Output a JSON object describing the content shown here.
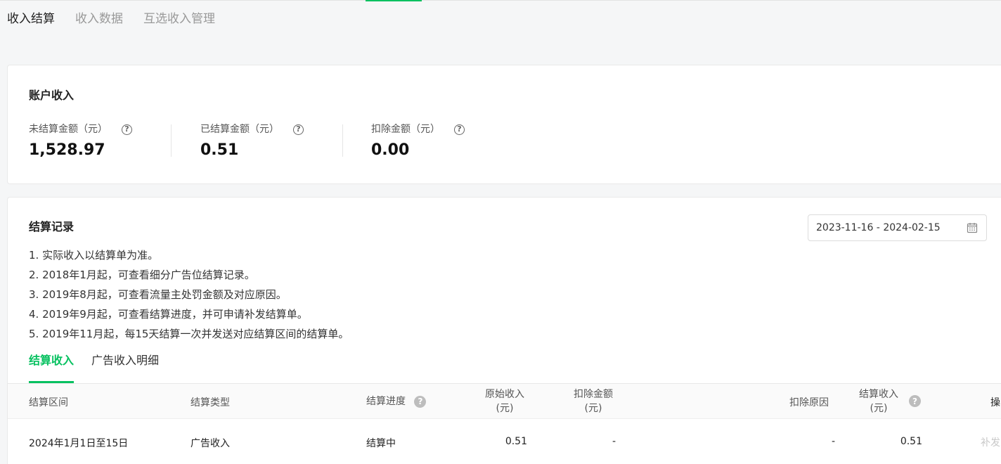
{
  "page_tabs": [
    "收入结算",
    "收入数据",
    "互选收入管理"
  ],
  "account": {
    "title": "账户收入",
    "metrics": [
      {
        "label": "未结算金额（元）",
        "value": "1,528.97"
      },
      {
        "label": "已结算金额（元）",
        "value": "0.51"
      },
      {
        "label": "扣除金额（元）",
        "value": "0.00"
      }
    ]
  },
  "records": {
    "title": "结算记录",
    "date_range": "2023-11-16 - 2024-02-15",
    "notes": [
      "1. 实际收入以结算单为准。",
      "2. 2018年1月起，可查看细分广告位结算记录。",
      "3. 2019年8月起，可查看流量主处罚金额及对应原因。",
      "4. 2019年9月起，可查看结算进度，并可申请补发结算单。",
      "5. 2019年11月起，每15天结算一次并发送对应结算区间的结算单。"
    ],
    "tabs": [
      "结算收入",
      "广告收入明细"
    ],
    "columns": {
      "period": "结算区间",
      "type": "结算类型",
      "progress": "结算进度",
      "original_1": "原始收入",
      "original_2": "(元)",
      "deduct_1": "扣除金额",
      "deduct_2": "(元)",
      "reason": "扣除原因",
      "settled_1": "结算收入",
      "settled_2": "(元)",
      "op": "操"
    },
    "rows": [
      {
        "period": "2024年1月1日至15日",
        "type": "广告收入",
        "progress": "结算中",
        "original": "0.51",
        "deduct": "-",
        "reason": "-",
        "settled": "0.51",
        "action": "补发"
      }
    ]
  },
  "colors": {
    "accent": "#07c160"
  }
}
